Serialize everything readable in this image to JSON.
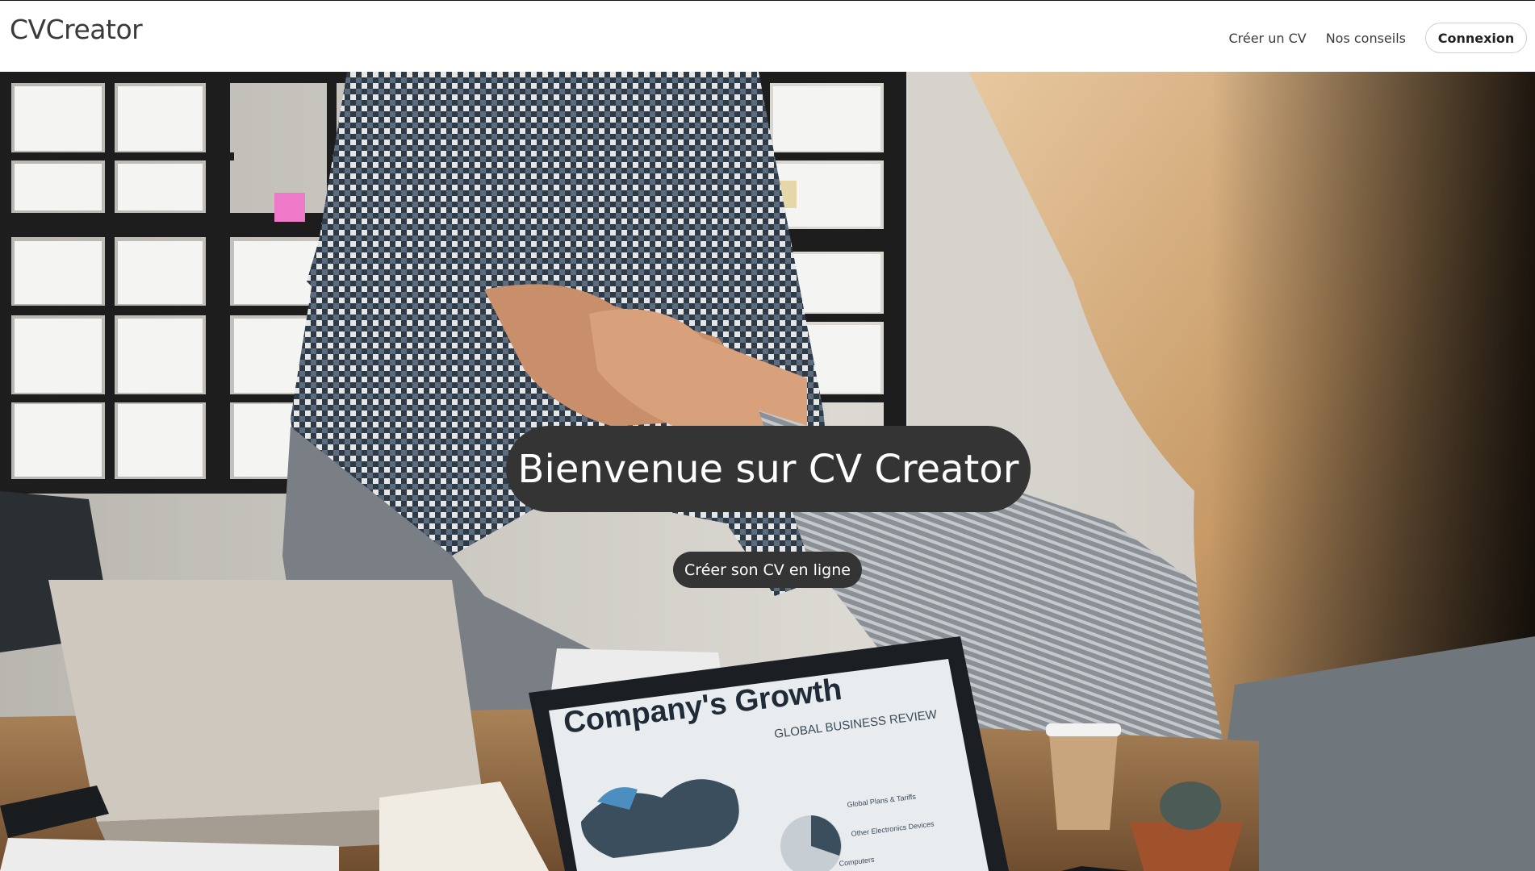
{
  "header": {
    "brand": "CVCreator",
    "nav": {
      "create_cv": "Créer un CV",
      "tips": "Nos conseils",
      "login": "Connexion"
    }
  },
  "hero": {
    "title": "Bienvenue sur CV Creator",
    "cta": "Créer son CV en ligne",
    "photo": {
      "laptop_title": "Company's Growth",
      "laptop_subtitle": "GLOBAL BUSINESS REVIEW",
      "chart_legend_1": "Global Plans & Tariffs",
      "chart_legend_2": "Other Electronics Devices",
      "chart_legend_3": "Computers"
    }
  },
  "colors": {
    "pill_background": "#343434",
    "pill_text": "#ffffff",
    "header_background": "#ffffff",
    "brand_text": "#3a3a3a"
  }
}
